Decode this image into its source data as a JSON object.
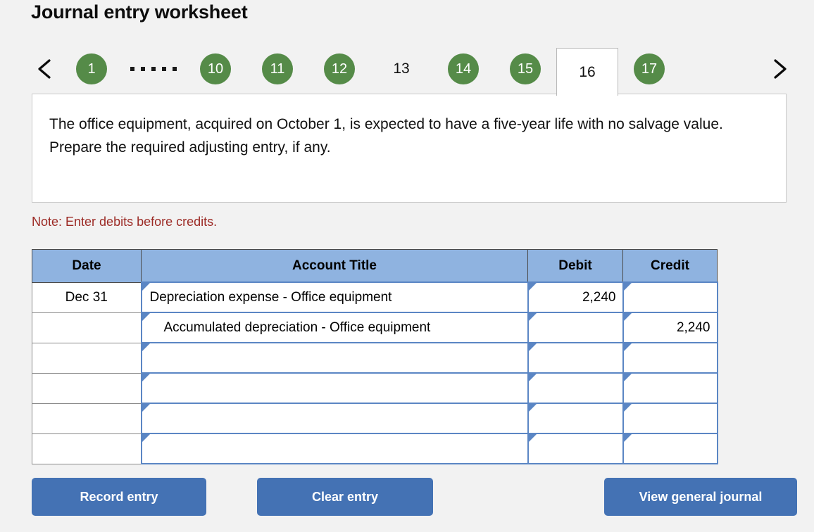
{
  "header": {
    "title": "Journal entry worksheet"
  },
  "pager": {
    "prev_icon": "chevron-left-icon",
    "next_icon": "chevron-right-icon",
    "ellipsis": "·····",
    "items": [
      {
        "label": "1",
        "state": "completed"
      },
      {
        "label": "ellipsis",
        "state": "ellipsis"
      },
      {
        "label": "10",
        "state": "completed"
      },
      {
        "label": "11",
        "state": "completed"
      },
      {
        "label": "12",
        "state": "completed"
      },
      {
        "label": "13",
        "state": "plain"
      },
      {
        "label": "14",
        "state": "completed"
      },
      {
        "label": "15",
        "state": "completed"
      },
      {
        "label": "16",
        "state": "active"
      },
      {
        "label": "17",
        "state": "completed"
      }
    ],
    "completed_color": "#558b48"
  },
  "question": {
    "text": "The office equipment, acquired on October 1, is expected to have a five-year life with no salvage value. Prepare the required adjusting entry, if any."
  },
  "note": {
    "text": "Note: Enter debits before credits.",
    "color": "#9c2a25"
  },
  "table": {
    "header_color": "#8fb3e0",
    "columns": [
      "Date",
      "Account Title",
      "Debit",
      "Credit"
    ],
    "rows": [
      {
        "date": "Dec 31",
        "account": "Depreciation expense - Office equipment",
        "indent": false,
        "debit": "2,240",
        "credit": ""
      },
      {
        "date": "",
        "account": "Accumulated depreciation - Office equipment",
        "indent": true,
        "debit": "",
        "credit": "2,240"
      },
      {
        "date": "",
        "account": "",
        "indent": false,
        "debit": "",
        "credit": ""
      },
      {
        "date": "",
        "account": "",
        "indent": false,
        "debit": "",
        "credit": ""
      },
      {
        "date": "",
        "account": "",
        "indent": false,
        "debit": "",
        "credit": ""
      },
      {
        "date": "",
        "account": "",
        "indent": false,
        "debit": "",
        "credit": ""
      }
    ]
  },
  "buttons": {
    "record": "Record entry",
    "clear": "Clear entry",
    "view": "View general journal",
    "color": "#4472b4"
  }
}
